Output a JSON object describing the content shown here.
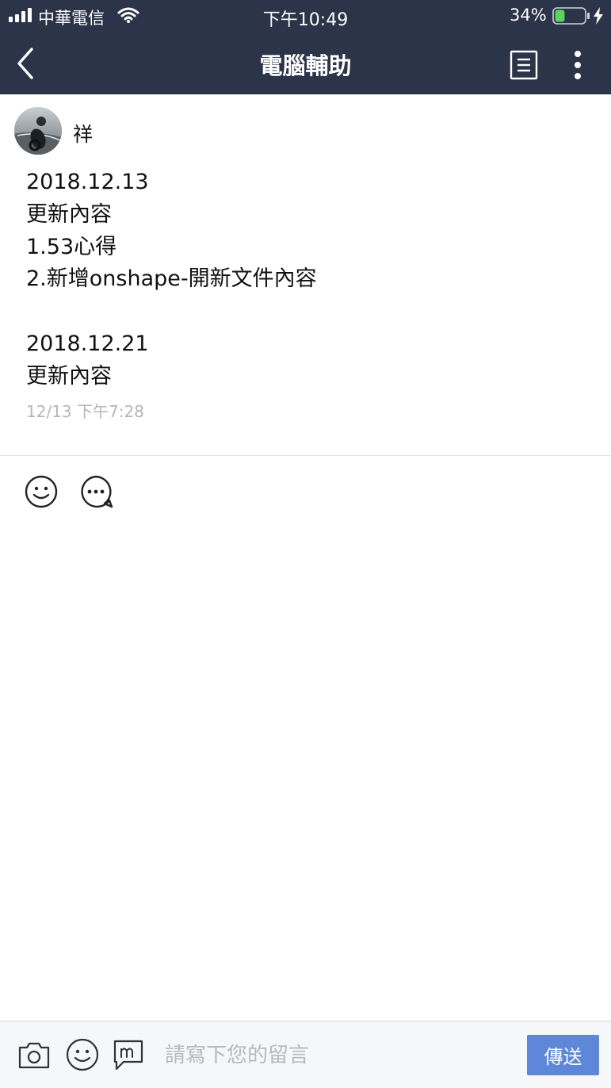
{
  "status_bar": {
    "carrier": "中華電信",
    "time": "下午10:49",
    "battery_percent": "34%",
    "battery_level": 0.34,
    "icons": [
      "signal-icon",
      "wifi-icon",
      "battery-icon",
      "charging-icon"
    ]
  },
  "nav": {
    "title": "電腦輔助",
    "icons": [
      "back-chevron-icon",
      "list-icon",
      "more-vertical-icon"
    ]
  },
  "post": {
    "author": "祥",
    "lines": [
      "2018.12.13",
      "更新內容",
      "1.53心得",
      "2.新增onshape-開新文件內容",
      "",
      "2018.12.21",
      "更新內容"
    ],
    "timestamp": "12/13 下午7:28"
  },
  "reactions": {
    "icons": [
      "smiley-icon",
      "comment-icon"
    ]
  },
  "composer": {
    "placeholder": "請寫下您的留言",
    "send_label": "傳送",
    "icons": [
      "camera-icon",
      "sticker-icon",
      "message-m-icon"
    ]
  },
  "colors": {
    "header_bg": "#2b3448",
    "accent": "#5f87d9",
    "battery_fill": "#5cd65c",
    "meta_text": "#b3b6bb"
  }
}
